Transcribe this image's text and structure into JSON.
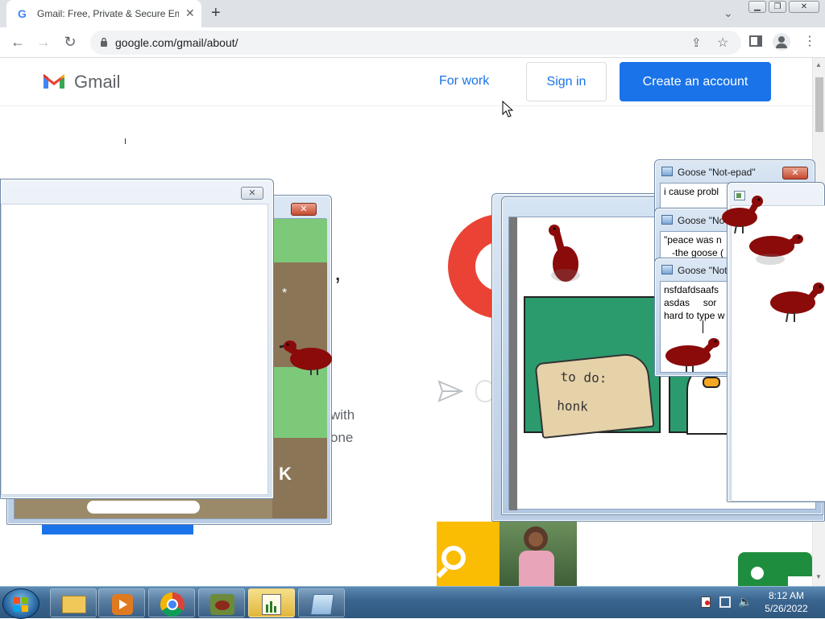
{
  "browser": {
    "tab_title": "Gmail: Free, Private & Secure Em",
    "tab_favicon": "G",
    "url": "google.com/gmail/about/"
  },
  "gmail": {
    "logo_text": "Gmail",
    "for_work": "For work",
    "sign_in": "Sign in",
    "create_account": "Create an account",
    "partial_texts": [
      "with",
      "one",
      "K"
    ]
  },
  "notes": [
    {
      "title": "Goose \"Not-epad\"",
      "text": "i cause probl"
    },
    {
      "title": "Goose \"No",
      "text": "\"peace was n\n   -the goose ("
    },
    {
      "title": "Goose \"Not",
      "text": "nsfdafdsaafs\nasdas     sor\nhard to type w"
    }
  ],
  "comic": {
    "note_line1": "to do:",
    "note_line2": "honk"
  },
  "taskbar": {
    "time": "8:12 AM",
    "date": "5/26/2022"
  },
  "colors": {
    "gmail_blue": "#1a73e8",
    "goose_red": "#8b0a0a",
    "comic_green": "#2b9b6d"
  }
}
